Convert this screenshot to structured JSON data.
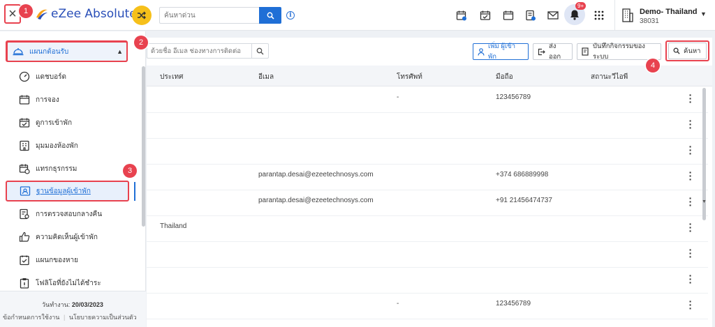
{
  "app": {
    "name": "eZee Absolute"
  },
  "header": {
    "quick_search_placeholder": "ค้นหาด่วน",
    "notification_count": "9+",
    "property_name": "Demo- Thailand",
    "property_code": "38031"
  },
  "markers": [
    "1",
    "2",
    "3",
    "4"
  ],
  "sidebar": {
    "department_label": "แผนกต้อนรับ",
    "items": [
      {
        "label": "แดชบอร์ด",
        "icon": "speedometer-icon"
      },
      {
        "label": "การจอง",
        "icon": "calendar-icon"
      },
      {
        "label": "ดูการเข้าพัก",
        "icon": "calendar-check-icon"
      },
      {
        "label": "มุมมองห้องพัก",
        "icon": "room-grid-icon"
      },
      {
        "label": "แทรกธุรกรรม",
        "icon": "calendar-clock-icon"
      },
      {
        "label": "ฐานข้อมูลผู้เข้าพัก",
        "icon": "guest-card-icon",
        "active": true
      },
      {
        "label": "การตรวจสอบกลางคืน",
        "icon": "audit-icon"
      },
      {
        "label": "ความคิดเห็นผู้เข้าพัก",
        "icon": "thumbs-up-icon"
      },
      {
        "label": "แผนกของหาย",
        "icon": "lost-found-icon"
      },
      {
        "label": "โฟลิโอที่ยังไม่ได้ชำระ",
        "icon": "clipboard-icon"
      }
    ],
    "footer": {
      "work_date_label": "วันทำงาน:",
      "work_date": "20/03/2023",
      "terms_link": "ข้อกำหนดการใช้งาน",
      "privacy_link": "นโยบายความเป็นส่วนตัว"
    }
  },
  "toolbar": {
    "search_placeholder": "ด้วยชื่อ อีเมล ช่องทางการติดต่อ",
    "add_guest_label": "เพิ่ม ผู้เข้าพัก",
    "export_label": "ส่งออก",
    "audit_trail_label": "บันทึกกิจกรรมของระบบ",
    "search_label": "ค้นหา"
  },
  "table": {
    "columns": [
      "ประเทศ",
      "อีเมล",
      "โทรศัพท์",
      "มือถือ",
      "สถานะวีไอพี"
    ],
    "rows": [
      {
        "country": "",
        "email": "",
        "phone": "-",
        "mobile": "123456789",
        "vip": ""
      },
      {
        "country": "",
        "email": "",
        "phone": "",
        "mobile": "",
        "vip": ""
      },
      {
        "country": "",
        "email": "",
        "phone": "",
        "mobile": "",
        "vip": ""
      },
      {
        "country": "",
        "email": "parantap.desai@ezeetechnosys.com",
        "phone": "",
        "mobile": "+374 686889998",
        "vip": ""
      },
      {
        "country": "",
        "email": "parantap.desai@ezeetechnosys.com",
        "phone": "",
        "mobile": "+91 21456474737",
        "vip": ""
      },
      {
        "country": "Thailand",
        "email": "",
        "phone": "",
        "mobile": "",
        "vip": ""
      },
      {
        "country": "",
        "email": "",
        "phone": "",
        "mobile": "",
        "vip": ""
      },
      {
        "country": "",
        "email": "",
        "phone": "",
        "mobile": "",
        "vip": ""
      },
      {
        "country": "",
        "email": "",
        "phone": "-",
        "mobile": "123456789",
        "vip": ""
      }
    ]
  },
  "colors": {
    "accent": "#1f6fd6",
    "annotation": "#e8424f",
    "shuffle": "#f6c01a"
  }
}
